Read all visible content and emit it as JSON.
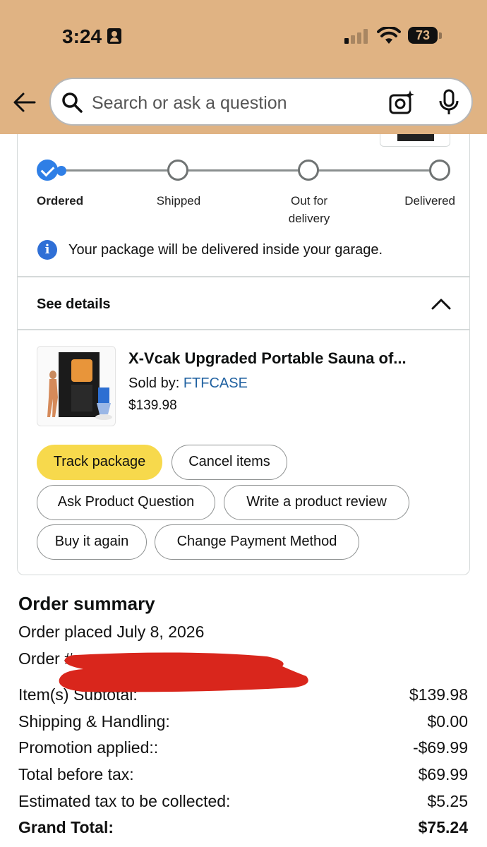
{
  "status_bar": {
    "time": "3:24",
    "battery": "73"
  },
  "search": {
    "placeholder": "Search or ask a question"
  },
  "tracker": {
    "steps": [
      {
        "label": "Ordered"
      },
      {
        "label": "Shipped"
      },
      {
        "label": "Out for\ndelivery"
      },
      {
        "label": "Delivered"
      }
    ]
  },
  "notice": "Your package will be delivered inside your garage.",
  "details": {
    "label": "See details"
  },
  "product": {
    "title": "X-Vcak Upgraded Portable Sauna of...",
    "sold_by_label": "Sold by: ",
    "seller": "FTFCASE",
    "price": "$139.98"
  },
  "actions": {
    "track": "Track package",
    "cancel": "Cancel items",
    "ask": "Ask Product Question",
    "review": "Write a product review",
    "buy_again": "Buy it again",
    "change_payment": "Change Payment Method"
  },
  "summary": {
    "title": "Order summary",
    "placed": "Order placed July 8, 2026",
    "order_number_label": "Order #",
    "rows": [
      {
        "label": "Item(s) Subtotal:",
        "value": "$139.98"
      },
      {
        "label": "Shipping & Handling:",
        "value": "$0.00"
      },
      {
        "label": "Promotion applied::",
        "value": "-$69.99"
      },
      {
        "label": "Total before tax:",
        "value": "$69.99"
      },
      {
        "label": "Estimated tax to be collected:",
        "value": "$5.25"
      },
      {
        "label": "Grand Total:",
        "value": "$75.24"
      }
    ]
  },
  "colors": {
    "header": "#e0b383",
    "primary_button": "#f7d94c",
    "link": "#2162a1",
    "progress": "#2f7fe6",
    "redaction": "#d9261c"
  }
}
